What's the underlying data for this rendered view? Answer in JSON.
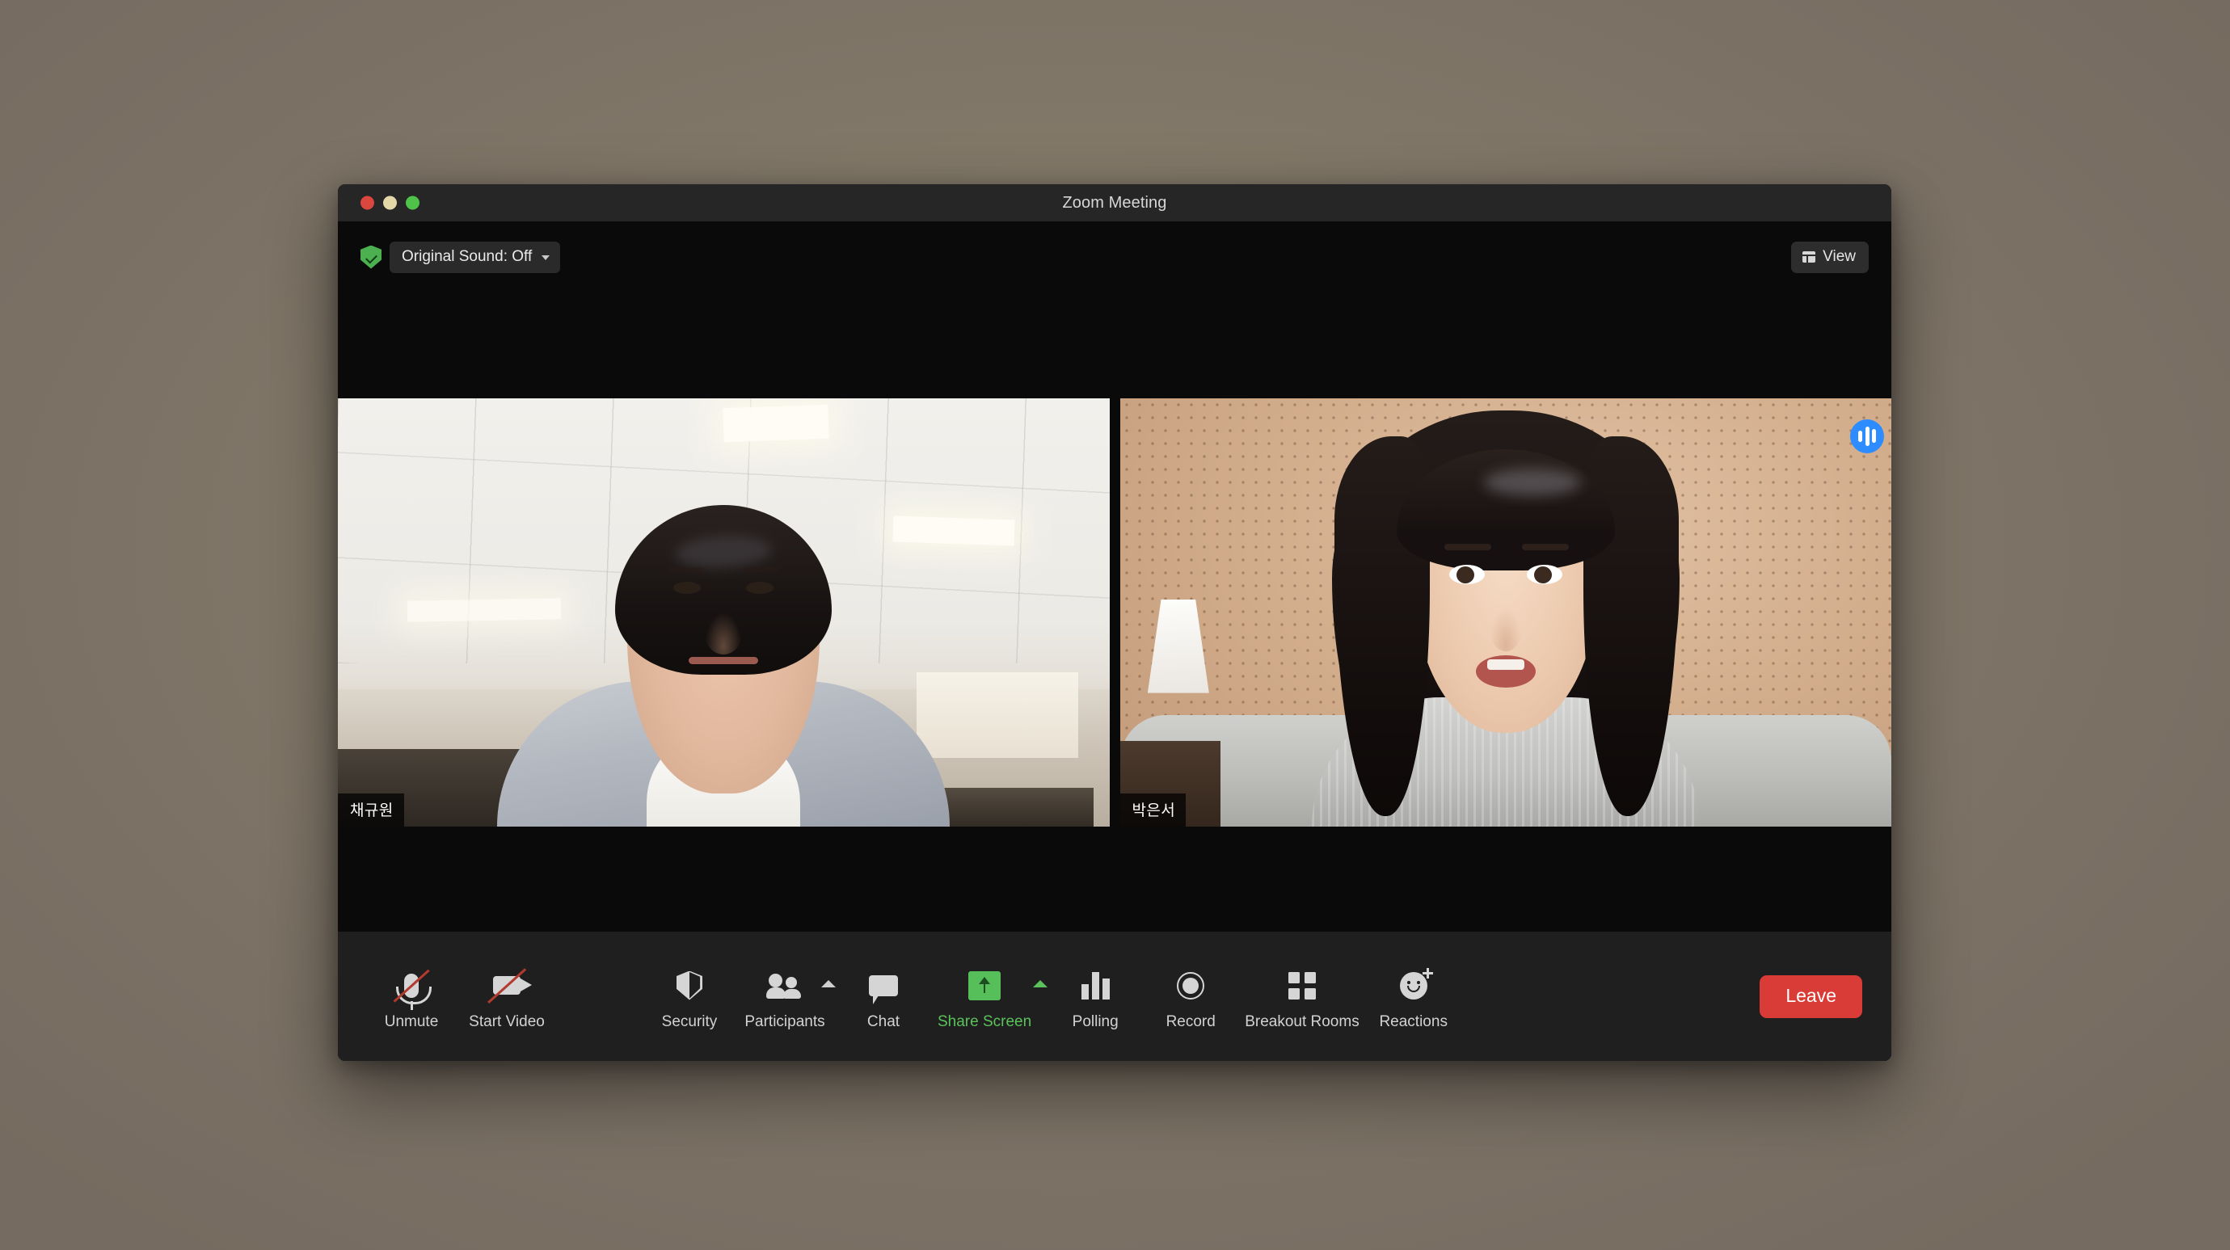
{
  "window": {
    "title": "Zoom Meeting",
    "traffic_lights": [
      "close",
      "minimize",
      "maximize"
    ]
  },
  "top_bar": {
    "original_sound": {
      "label": "Original Sound: Off",
      "shield_icon": "shield-check-icon",
      "caret_icon": "caret-down-icon"
    },
    "view": {
      "label": "View",
      "icon": "grid-view-icon"
    }
  },
  "participants": [
    {
      "name": "채규원",
      "speaking": false,
      "video_on": true
    },
    {
      "name": "박은서",
      "speaking": true,
      "video_on": true,
      "speaking_icon": "audio-levels-icon"
    }
  ],
  "toolbar": {
    "items": [
      {
        "label": "Unmute",
        "icon": "microphone-muted-icon",
        "muted": true,
        "has_chevron": false,
        "active": false
      },
      {
        "label": "Start Video",
        "icon": "video-camera-off-icon",
        "muted": true,
        "has_chevron": false,
        "active": false
      },
      {
        "label": "Security",
        "icon": "shield-icon",
        "muted": false,
        "has_chevron": false,
        "active": false
      },
      {
        "label": "Participants",
        "icon": "people-icon",
        "muted": false,
        "has_chevron": true,
        "active": false
      },
      {
        "label": "Chat",
        "icon": "chat-bubble-icon",
        "muted": false,
        "has_chevron": false,
        "active": false
      },
      {
        "label": "Share Screen",
        "icon": "share-screen-icon",
        "muted": false,
        "has_chevron": true,
        "active": true
      },
      {
        "label": "Polling",
        "icon": "bar-chart-icon",
        "muted": false,
        "has_chevron": false,
        "active": false
      },
      {
        "label": "Record",
        "icon": "record-circle-icon",
        "muted": false,
        "has_chevron": false,
        "active": false
      },
      {
        "label": "Breakout Rooms",
        "icon": "grid-squares-icon",
        "muted": false,
        "has_chevron": false,
        "active": false
      },
      {
        "label": "Reactions",
        "icon": "smiley-plus-icon",
        "muted": false,
        "has_chevron": false,
        "active": false
      }
    ],
    "leave_label": "Leave"
  },
  "colors": {
    "leave_red": "#d93b36",
    "share_green": "#5bc15b",
    "speaking_blue": "#2d8cff",
    "shield_green": "#4caf50",
    "window_bg": "#0a0a0a",
    "toolbar_bg": "#1f1f1f",
    "titlebar_bg": "#262626",
    "desktop_bg": "#837969"
  }
}
